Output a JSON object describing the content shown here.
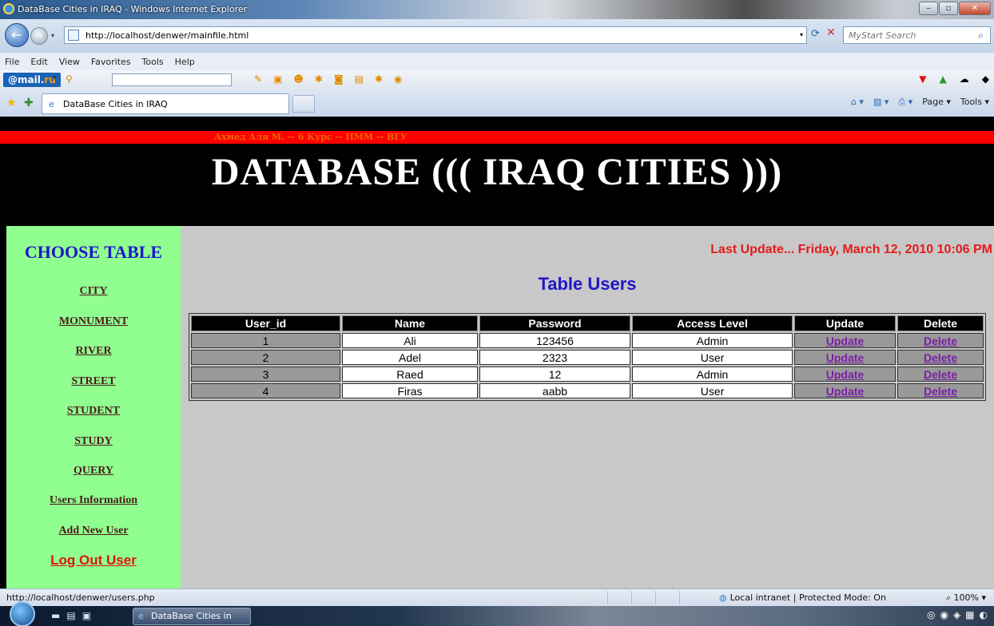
{
  "window": {
    "title": "DataBase Cities in IRAQ - Windows Internet Explorer",
    "controls": {
      "minimize": "‒",
      "maximize": "▫",
      "close": "✕"
    }
  },
  "address": {
    "url": "http://localhost/denwer/mainfile.html",
    "search_placeholder": "MyStart Search"
  },
  "menu": [
    "File",
    "Edit",
    "View",
    "Favorites",
    "Tools",
    "Help"
  ],
  "mail_toolbar": {
    "logo_main": "@mail.",
    "logo_ru": "ru"
  },
  "tab": {
    "label": "DataBase Cities in IRAQ"
  },
  "command_bar": {
    "page": "Page ▾",
    "tools": "Tools ▾"
  },
  "page": {
    "author": "Ахмед Аля М. -- 6 Курс -- ПММ -- ВГУ",
    "banner": "DATABASE ((( IRAQ CITIES )))",
    "sidebar": {
      "heading": "CHOOSE TABLE",
      "links": [
        "CITY",
        "MONUMENT",
        "RIVER",
        "STREET",
        "STUDENT",
        "STUDY",
        "QUERY",
        "Users Information",
        "Add New User"
      ],
      "logout": "Log Out User"
    },
    "last_update": "Last Update... Friday, March 12, 2010 10:06 PM",
    "table_title": "Table Users",
    "table": {
      "headers": [
        "User_id",
        "Name",
        "Password",
        "Access Level",
        "Update",
        "Delete"
      ],
      "rows": [
        {
          "id": "1",
          "name": "Ali",
          "password": "123456",
          "access": "Admin",
          "update": "Update",
          "delete": "Delete"
        },
        {
          "id": "2",
          "name": "Adel",
          "password": "2323",
          "access": "User",
          "update": "Update",
          "delete": "Delete"
        },
        {
          "id": "3",
          "name": "Raed",
          "password": "12",
          "access": "Admin",
          "update": "Update",
          "delete": "Delete"
        },
        {
          "id": "4",
          "name": "Firas",
          "password": "aabb",
          "access": "User",
          "update": "Update",
          "delete": "Delete"
        }
      ]
    }
  },
  "status": {
    "url": "http://localhost/denwer/users.php",
    "zone": "Local intranet | Protected Mode: On",
    "zoom": "100%"
  },
  "taskbar": {
    "task": "DataBase Cities in IR..."
  },
  "colors": {
    "accent_red": "#ff0000",
    "nav_green": "#90ff90",
    "content_gray": "#c8c8c8",
    "title_blue": "#2016c8"
  }
}
